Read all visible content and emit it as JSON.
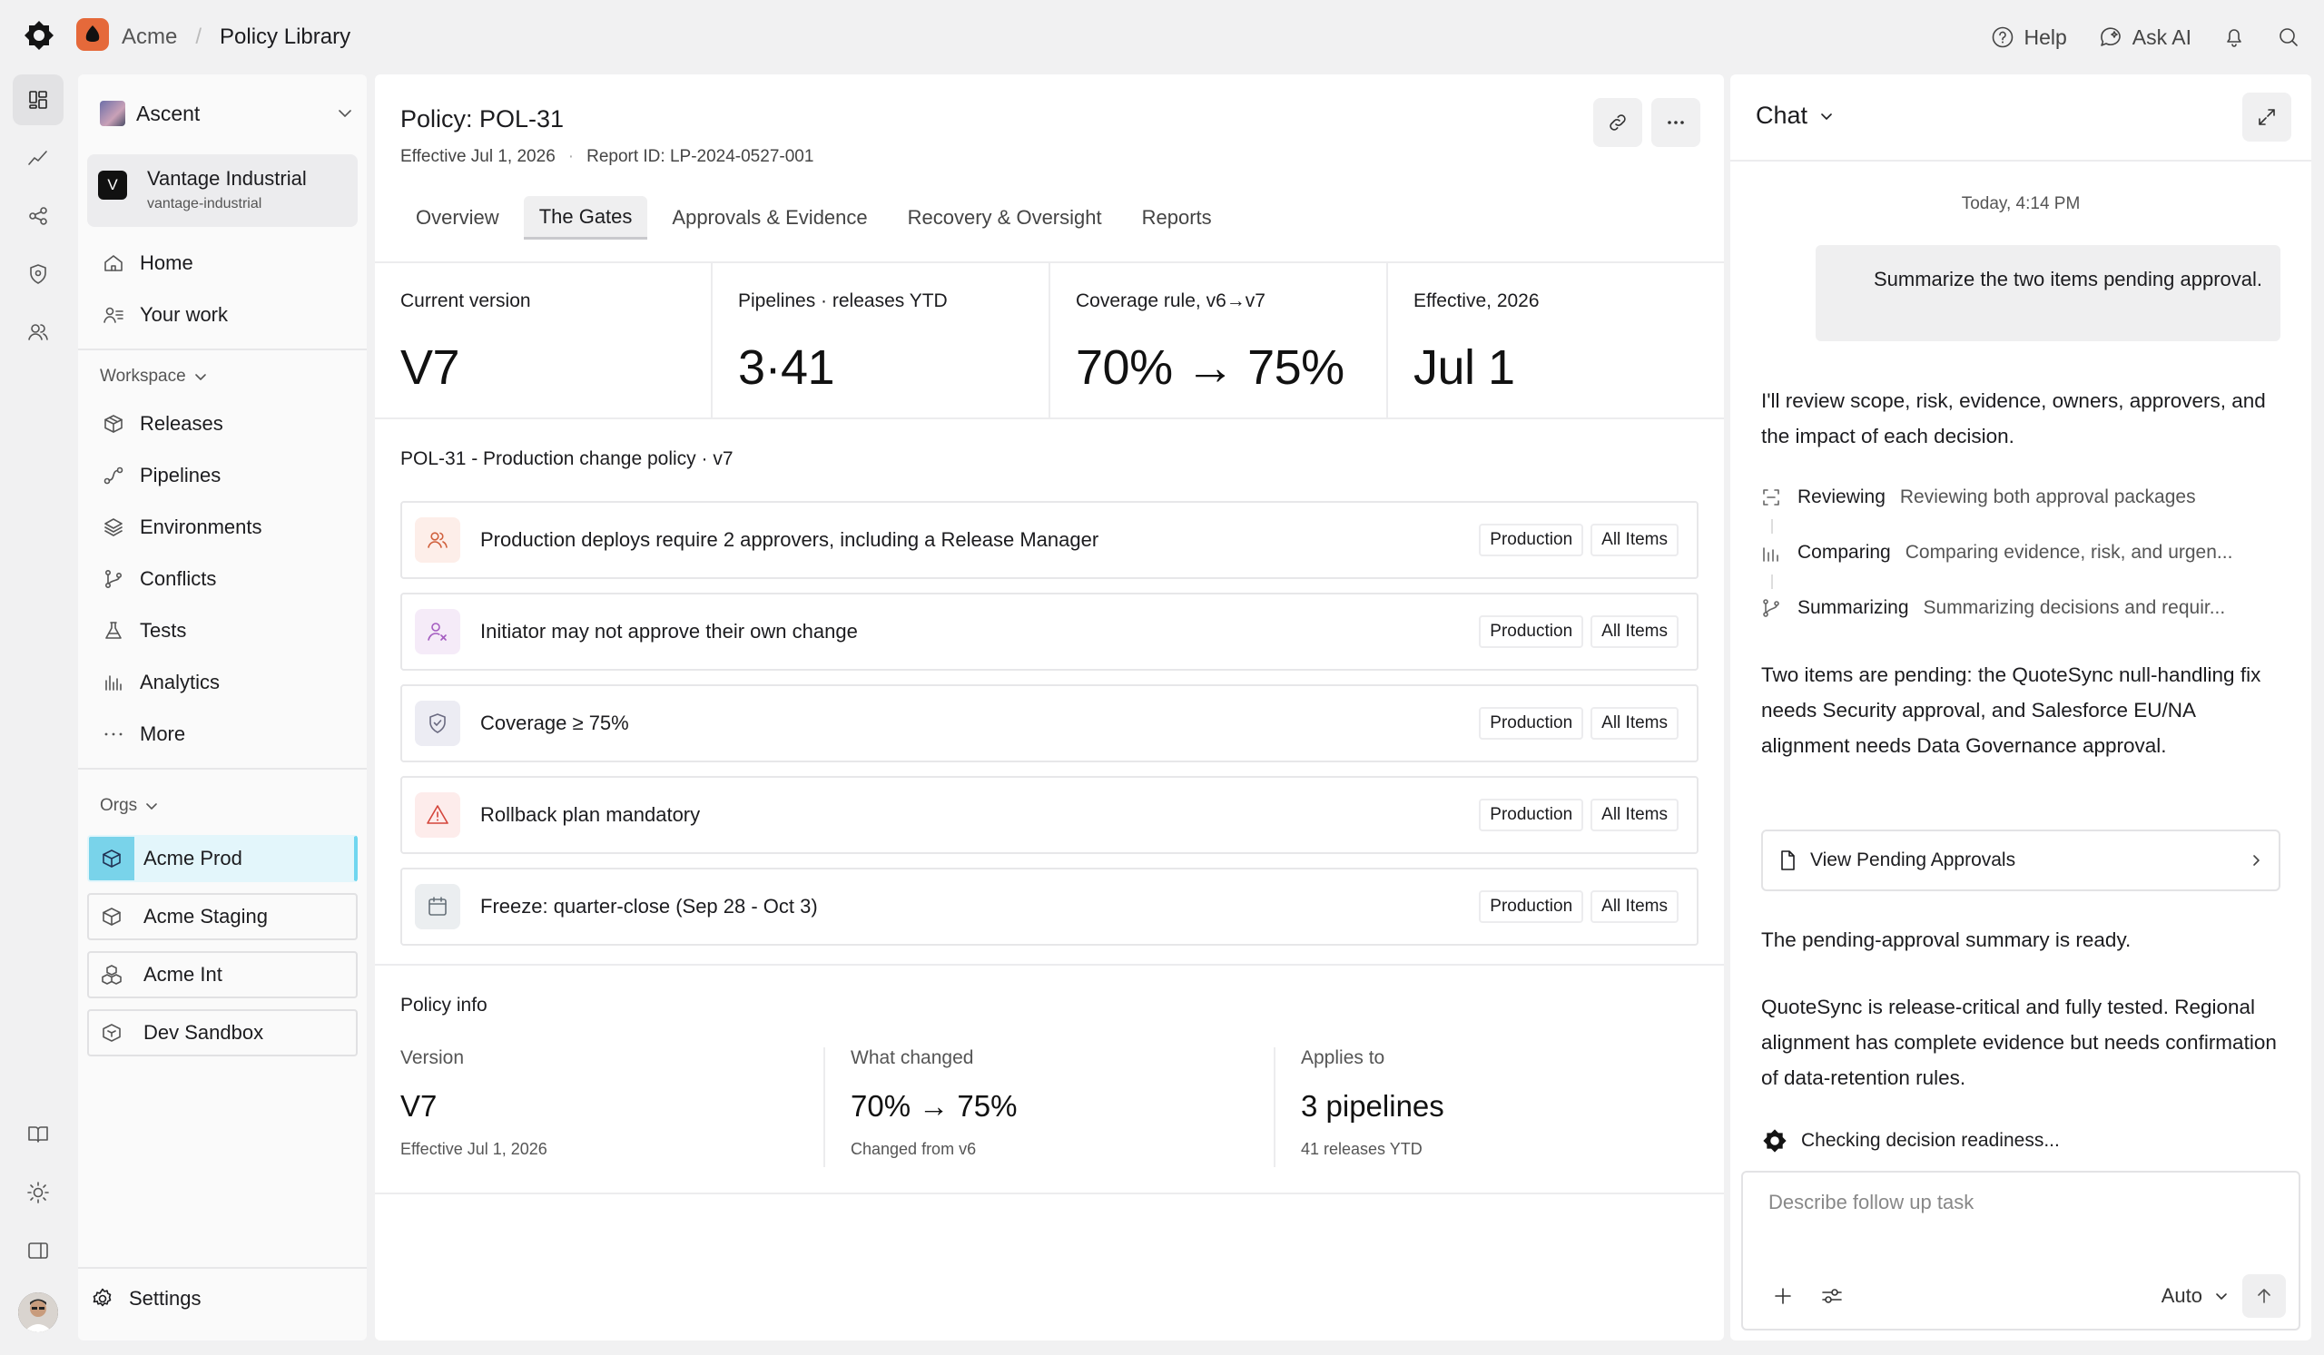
{
  "topbar": {
    "org": "Acme",
    "separator": "/",
    "page": "Policy Library",
    "help_label": "Help",
    "ask_ai_label": "Ask AI"
  },
  "sidebar": {
    "workspace": "Ascent",
    "org_card": {
      "initial": "V",
      "name": "Vantage Industrial",
      "slug": "vantage-industrial"
    },
    "top_items": [
      {
        "label": "Home",
        "icon": "home-icon"
      },
      {
        "label": "Your work",
        "icon": "user-list-icon"
      }
    ],
    "workspace_label": "Workspace",
    "workspace_items": [
      {
        "label": "Releases",
        "icon": "package-icon"
      },
      {
        "label": "Pipelines",
        "icon": "pipeline-icon"
      },
      {
        "label": "Environments",
        "icon": "layers-icon"
      },
      {
        "label": "Conflicts",
        "icon": "branch-icon"
      },
      {
        "label": "Tests",
        "icon": "flask-icon"
      },
      {
        "label": "Analytics",
        "icon": "bar-chart-icon"
      },
      {
        "label": "More",
        "icon": "more-icon"
      }
    ],
    "orgs_label": "Orgs",
    "orgs": [
      {
        "label": "Acme Prod",
        "selected": true
      },
      {
        "label": "Acme Staging",
        "selected": false
      },
      {
        "label": "Acme Int",
        "selected": false
      },
      {
        "label": "Dev Sandbox",
        "selected": false
      }
    ],
    "settings_label": "Settings"
  },
  "main": {
    "title": "Policy: POL-31",
    "effective": "Effective Jul 1, 2026",
    "report_id": "Report ID: LP-2024-0527-001",
    "tabs": [
      {
        "label": "Overview",
        "active": false
      },
      {
        "label": "The Gates",
        "active": true
      },
      {
        "label": "Approvals & Evidence",
        "active": false
      },
      {
        "label": "Recovery & Oversight",
        "active": false
      },
      {
        "label": "Reports",
        "active": false
      }
    ],
    "stats": [
      {
        "label": "Current version",
        "value": "V7"
      },
      {
        "label": "Pipelines · releases YTD",
        "value": "3·41"
      },
      {
        "label": "Coverage rule, v6→v7",
        "value": "70% → 75%"
      },
      {
        "label": "Effective, 2026",
        "value": "Jul 1"
      }
    ],
    "rules_title": "POL-31 - Production change policy · v7",
    "rules": [
      {
        "text": "Production deploys require 2 approvers, including a Release Manager",
        "icon": "users-icon",
        "tag1": "Production",
        "tag2": "All Items",
        "tint": "#fdeee9",
        "color": "#d0603d"
      },
      {
        "text": "Initiator may not approve their own change",
        "icon": "user-x-icon",
        "tag1": "Production",
        "tag2": "All Items",
        "tint": "#f5ebf8",
        "color": "#a45cc0"
      },
      {
        "text": "Coverage ≥ 75%",
        "icon": "shield-check-icon",
        "tag1": "Production",
        "tag2": "All Items",
        "tint": "#ececf3",
        "color": "#6a6a80"
      },
      {
        "text": "Rollback plan mandatory",
        "icon": "warning-icon",
        "tag1": "Production",
        "tag2": "All Items",
        "tint": "#fdeceb",
        "color": "#d4453b"
      },
      {
        "text": "Freeze: quarter-close (Sep 28 - Oct 3)",
        "icon": "calendar-icon",
        "tag1": "Production",
        "tag2": "All Items",
        "tint": "#ebeef0",
        "color": "#667078"
      }
    ],
    "info_title": "Policy info",
    "info": [
      {
        "label": "Version",
        "value": "V7",
        "sub": "Effective Jul 1, 2026"
      },
      {
        "label": "What changed",
        "value": "70% → 75%",
        "sub": "Changed from v6"
      },
      {
        "label": "Applies to",
        "value": "3 pipelines",
        "sub": "41 releases YTD"
      }
    ]
  },
  "chat": {
    "title": "Chat",
    "timestamp": "Today, 4:14 PM",
    "user_message": "Summarize the two items pending approval.",
    "intro": "I'll review scope, risk, evidence, owners, approvers, and the impact of each decision.",
    "steps": [
      {
        "name": "Reviewing",
        "desc": "Reviewing both approval packages"
      },
      {
        "name": "Comparing",
        "desc": "Comparing evidence, risk, and urgen..."
      },
      {
        "name": "Summarizing",
        "desc": "Summarizing decisions and requir..."
      }
    ],
    "summary": "Two items are pending: the QuoteSync null-handling fix needs Security approval, and Salesforce EU/NA alignment needs Data Governance approval.",
    "view_pending_label": "View Pending Approvals",
    "ready": "The pending-approval summary is ready.",
    "detail": "QuoteSync is release-critical and fully tested. Regional alignment has complete evidence but needs confirmation of data-retention rules.",
    "checking": "Checking decision readiness...",
    "composer_placeholder": "Describe follow up task",
    "mode": "Auto"
  }
}
